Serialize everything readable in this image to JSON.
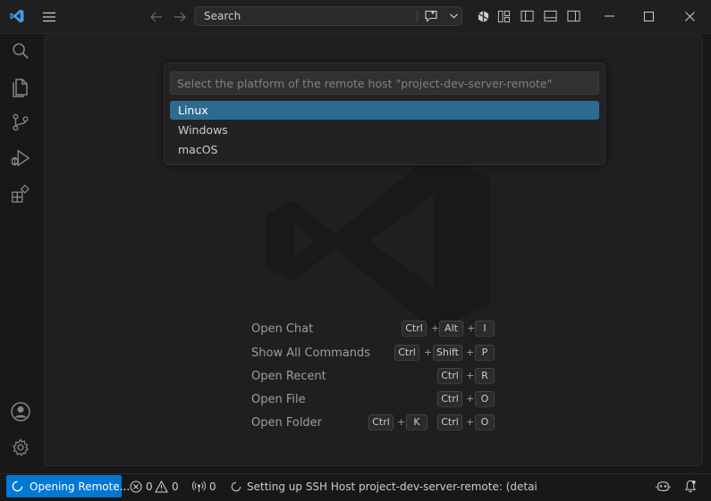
{
  "titlebar": {
    "search_label": "Search",
    "icons": [
      "vscode-logo-icon",
      "menu-icon",
      "back-arrow-icon",
      "forward-arrow-icon",
      "chat-icon",
      "chevron-down-icon",
      "copilot-icon",
      "layout-customize-icon",
      "toggle-primary-sidebar-icon",
      "toggle-panel-icon",
      "toggle-secondary-sidebar-icon",
      "minimize-icon",
      "maximize-icon",
      "close-icon"
    ]
  },
  "activitybar": {
    "items": [
      "explorer-search-icon",
      "explorer-files-icon",
      "source-control-icon",
      "run-debug-icon",
      "extensions-icon"
    ],
    "bottom": [
      "accounts-icon",
      "manage-gear-icon"
    ]
  },
  "quickpick": {
    "placeholder": "Select the platform of the remote host \"project-dev-server-remote\"",
    "options": [
      "Linux",
      "Windows",
      "macOS"
    ],
    "selected": "Linux"
  },
  "shortcuts": [
    {
      "label": "Open Chat",
      "keys": [
        "Ctrl",
        "+",
        "Alt",
        "+",
        "I"
      ]
    },
    {
      "label": "Show All Commands",
      "keys": [
        "Ctrl",
        "+",
        "Shift",
        "+",
        "P"
      ]
    },
    {
      "label": "Open Recent",
      "keys": [
        "Ctrl",
        "+",
        "R"
      ]
    },
    {
      "label": "Open File",
      "keys": [
        "Ctrl",
        "+",
        "O"
      ]
    },
    {
      "label": "Open Folder",
      "keys": [
        "Ctrl",
        "+",
        "K",
        "Ctrl",
        "+",
        "O"
      ]
    }
  ],
  "statusbar": {
    "remote_label": "Opening Remote...",
    "errors": "0",
    "warnings": "0",
    "ports": "0",
    "progress_text": "Setting up SSH Host project-dev-server-remote: (detai"
  },
  "colors": {
    "accent": "#0078d4",
    "selection": "#2e6b93"
  }
}
